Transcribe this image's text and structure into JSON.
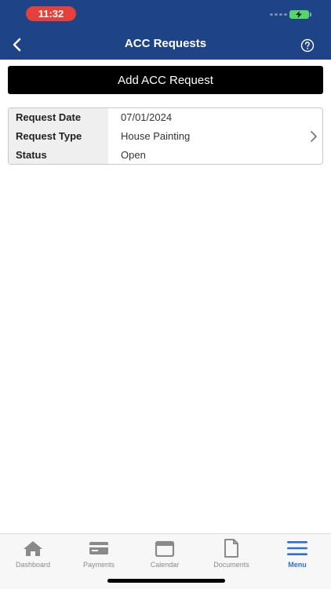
{
  "status_bar": {
    "time": "11:32"
  },
  "header": {
    "title": "ACC Requests"
  },
  "add_button_label": "Add ACC Request",
  "requests": [
    {
      "fields": [
        {
          "label": "Request Date",
          "value": "07/01/2024"
        },
        {
          "label": "Request Type",
          "value": "House Painting"
        },
        {
          "label": "Status",
          "value": "Open"
        }
      ]
    }
  ],
  "tabs": [
    {
      "label": "Dashboard",
      "icon": "home-icon",
      "active": false
    },
    {
      "label": "Payments",
      "icon": "credit-card-icon",
      "active": false
    },
    {
      "label": "Calendar",
      "icon": "calendar-icon",
      "active": false
    },
    {
      "label": "Documents",
      "icon": "document-icon",
      "active": false
    },
    {
      "label": "Menu",
      "icon": "hamburger-menu-icon",
      "active": true
    }
  ],
  "colors": {
    "header_bg": "#1f4387",
    "active_tab": "#2f6fd2",
    "inactive_tab": "#8a8a8a",
    "time_pill": "#e5403a",
    "battery": "#55d66a"
  }
}
